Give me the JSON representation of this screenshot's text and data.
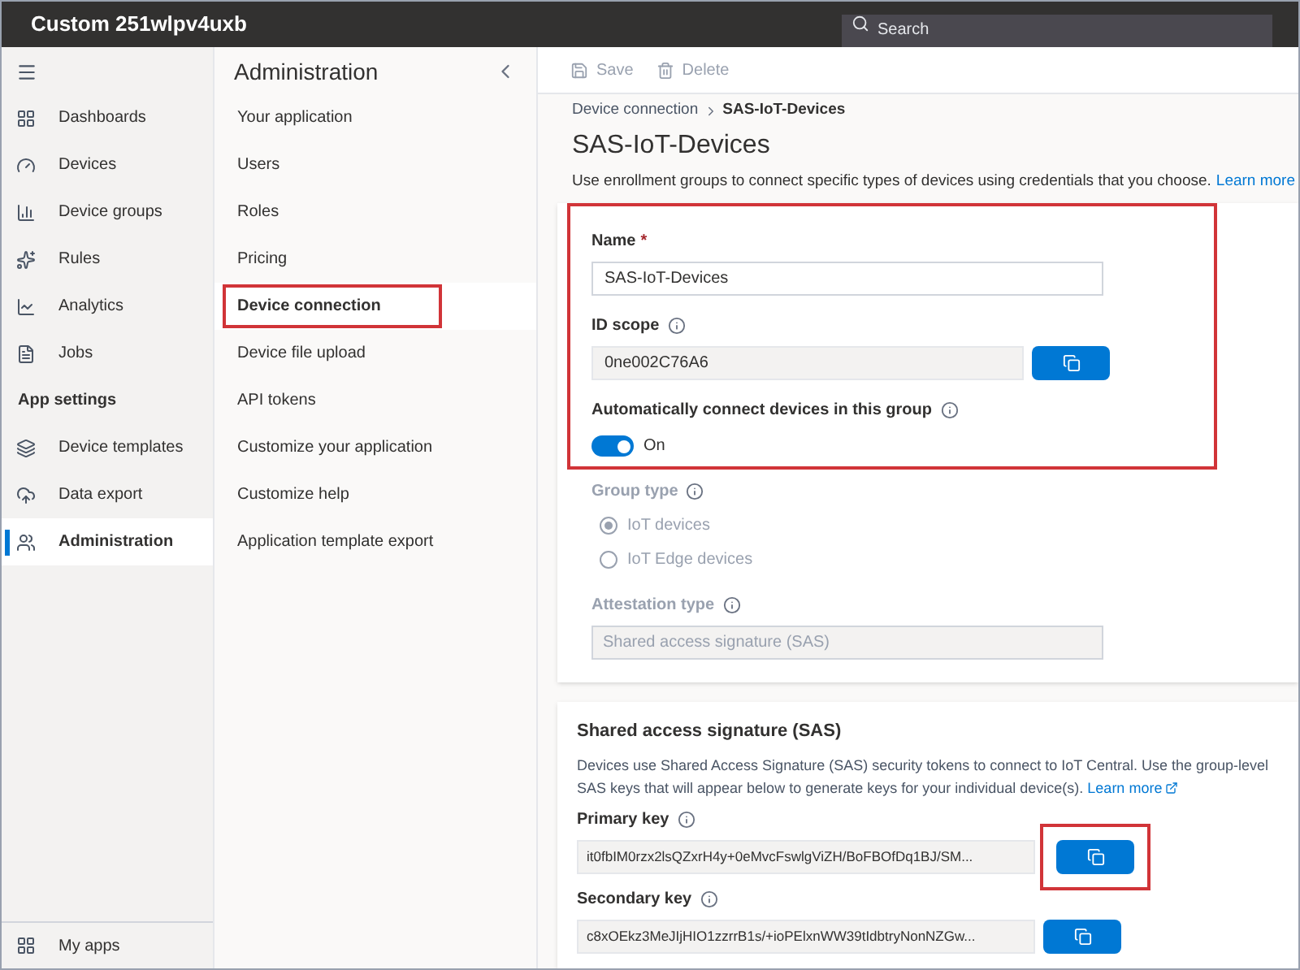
{
  "top_bar": {
    "title": "Custom 251wlpv4uxb",
    "search_placeholder": "Search"
  },
  "nav": {
    "items": [
      {
        "kind": "item",
        "label": "Dashboards",
        "selected": false
      },
      {
        "kind": "item",
        "label": "Devices",
        "selected": false
      },
      {
        "kind": "item",
        "label": "Device groups",
        "selected": false
      },
      {
        "kind": "item",
        "label": "Rules",
        "selected": false
      },
      {
        "kind": "item",
        "label": "Analytics",
        "selected": false
      },
      {
        "kind": "item",
        "label": "Jobs",
        "selected": false
      },
      {
        "kind": "header",
        "label": "App settings"
      },
      {
        "kind": "item",
        "label": "Device templates",
        "selected": false
      },
      {
        "kind": "item",
        "label": "Data export",
        "selected": false
      },
      {
        "kind": "item",
        "label": "Administration",
        "selected": true
      }
    ],
    "footer": "My apps"
  },
  "admin_panel": {
    "title": "Administration",
    "items": [
      {
        "label": "Your application",
        "selected": false,
        "highlighted": false
      },
      {
        "label": "Users",
        "selected": false,
        "highlighted": false
      },
      {
        "label": "Roles",
        "selected": false,
        "highlighted": false
      },
      {
        "label": "Pricing",
        "selected": false,
        "highlighted": false
      },
      {
        "label": "Device connection",
        "selected": true,
        "highlighted": true
      },
      {
        "label": "Device file upload",
        "selected": false,
        "highlighted": false
      },
      {
        "label": "API tokens",
        "selected": false,
        "highlighted": false
      },
      {
        "label": "Customize your application",
        "selected": false,
        "highlighted": false
      },
      {
        "label": "Customize help",
        "selected": false,
        "highlighted": false
      },
      {
        "label": "Application template export",
        "selected": false,
        "highlighted": false
      }
    ]
  },
  "toolbar": {
    "buttons": [
      {
        "label": "Save",
        "disabled": true
      },
      {
        "label": "Delete",
        "disabled": true
      }
    ]
  },
  "breadcrumb": [
    "Device connection",
    "SAS-IoT-Devices"
  ],
  "page": {
    "title": "SAS-IoT-Devices",
    "description": "Use enrollment groups to connect specific types of devices using credentials that you choose.",
    "link": "Learn more"
  },
  "group_form": {
    "highlighted": true,
    "name_label": "Name",
    "required": true,
    "required_mark": "*",
    "name_value": "SAS-IoT-Devices",
    "id_scope_label": "ID scope",
    "id_scope_value": "0ne002C76A6",
    "auto_connect_label": "Automatically connect devices in this group",
    "toggle": {
      "on": true,
      "label": "On"
    },
    "group_type": {
      "label": "Group type",
      "disabled": true,
      "options": [
        {
          "label": "IoT devices",
          "selected": true
        },
        {
          "label": "IoT Edge devices",
          "selected": false
        }
      ]
    },
    "attestation": {
      "label": "Attestation type",
      "value": "Shared access signature (SAS)"
    }
  },
  "sas": {
    "title": "Shared access signature (SAS)",
    "description": "Devices use Shared Access Signature (SAS) security tokens to connect to IoT Central. Use the group-level SAS keys that will appear below to generate keys for your individual device(s).",
    "link": "Learn more",
    "keys": [
      {
        "label": "Primary key",
        "value": "it0fbIM0rzx2lsQZxrH4y+0eMvcFswlgViZH/BoFBOfDq1BJ/SM...",
        "highlighted": true
      },
      {
        "label": "Secondary key",
        "value": "c8xOEkz3MeJIjHIO1zzrrB1s/+ioPElxnWW39tIdbtryNonNZGw...",
        "highlighted": false
      }
    ]
  }
}
